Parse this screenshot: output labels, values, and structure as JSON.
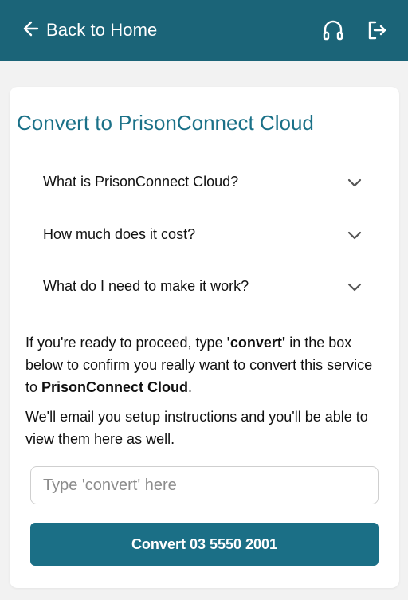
{
  "header": {
    "back_label": "Back to Home",
    "support_icon": "headset-icon",
    "logout_icon": "logout-icon",
    "background": "#1b6478"
  },
  "main": {
    "title": "Convert to PrisonConnect Cloud",
    "faq": [
      {
        "label": "What is PrisonConnect Cloud?"
      },
      {
        "label": "How much does it cost?"
      },
      {
        "label": "What do I need to make it work?"
      }
    ],
    "instructions": {
      "part1": "If you're ready to proceed, type ",
      "keyword": "'convert'",
      "part2": " in the box below to confirm you really want to convert this service to ",
      "service": "PrisonConnect Cloud",
      "part3": "."
    },
    "email_note": "We'll email you setup instructions and you'll be able to view them here as well.",
    "confirm_input": {
      "value": "",
      "placeholder": "Type 'convert' here"
    },
    "convert_button_label": "Convert 03 5550 2001",
    "accent": "#1b6f86"
  }
}
